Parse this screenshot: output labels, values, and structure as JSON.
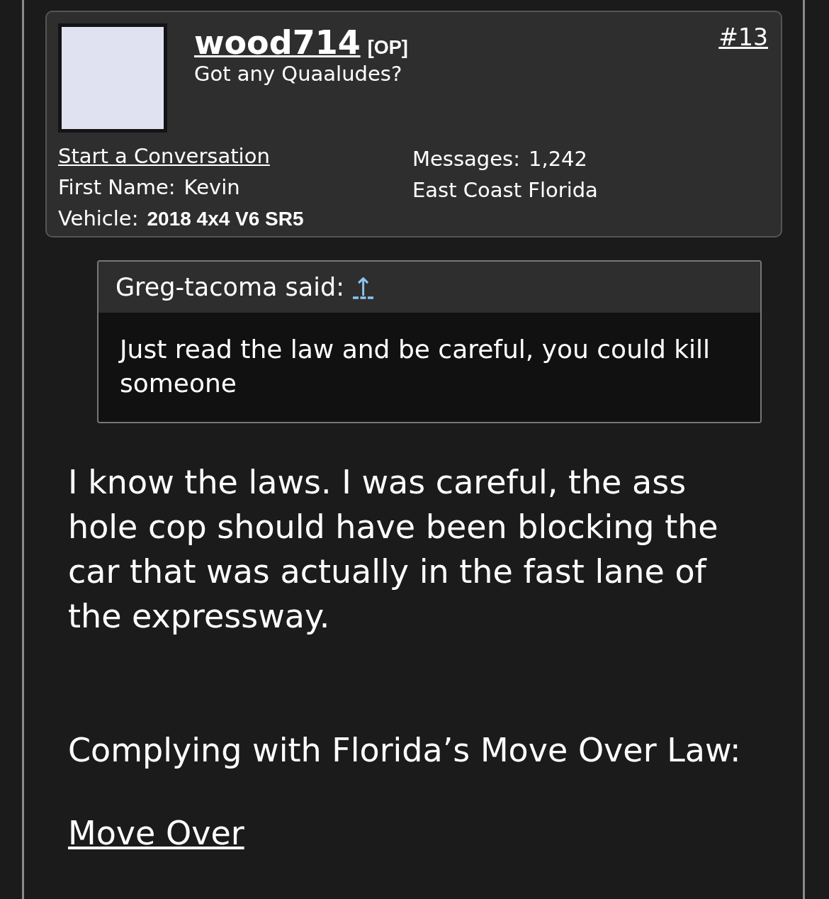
{
  "post": {
    "username": "wood714",
    "op_badge": "[OP]",
    "user_title": "Got any Quaaludes?",
    "post_number": "#13",
    "start_conversation": "Start a Conversation",
    "fields_left": [
      {
        "label": "First Name:",
        "value": "Kevin",
        "bold": false
      },
      {
        "label": "Vehicle:",
        "value": "2018 4x4 V6 SR5",
        "bold": true
      }
    ],
    "fields_right": [
      {
        "label": "Messages:",
        "value": "1,242"
      },
      {
        "value": "East Coast Florida"
      }
    ]
  },
  "quote": {
    "author": "Greg-tacoma said:",
    "jump_link": "↑",
    "text": "Just read the law and be careful, you could kill someone"
  },
  "body": [
    "I know the laws. I was careful, the ass hole cop should have been blocking the car that was actually in the fast lane of the expressway.",
    "Complying with Florida’s Move Over Law:"
  ],
  "link": "Move Over"
}
